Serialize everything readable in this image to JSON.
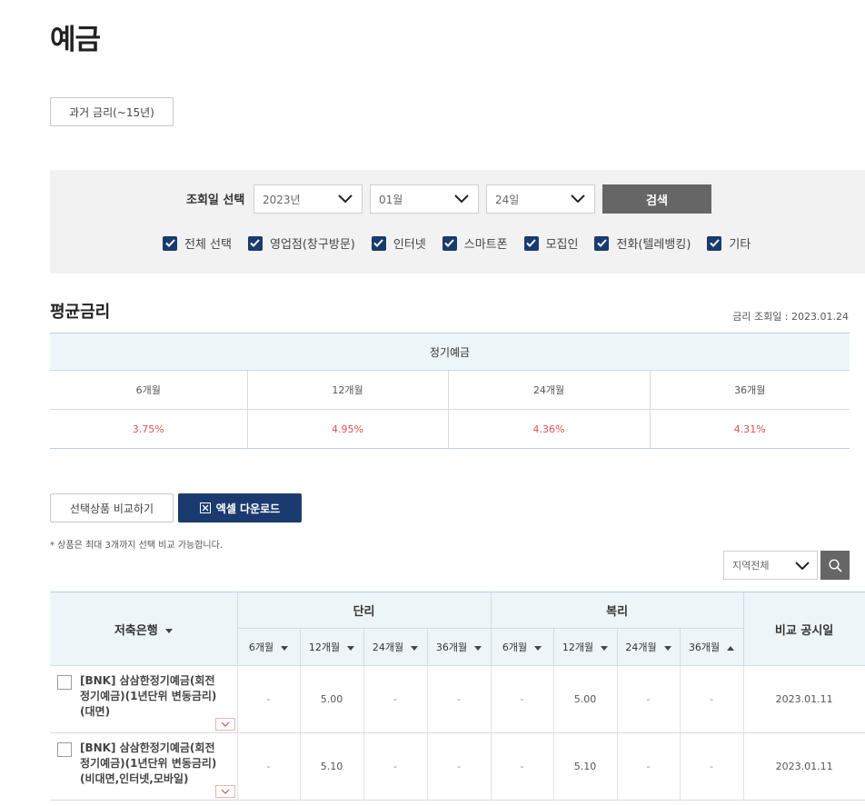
{
  "page": {
    "title": "예금",
    "past_rates_label": "과거 금리(~15년)"
  },
  "filter": {
    "label": "조회일 선택",
    "year": "2023년",
    "month": "01월",
    "day": "24일",
    "search_label": "검색",
    "channels": [
      {
        "label": "전체 선택",
        "checked": true
      },
      {
        "label": "영업점(창구방문)",
        "checked": true
      },
      {
        "label": "인터넷",
        "checked": true
      },
      {
        "label": "스마트폰",
        "checked": true
      },
      {
        "label": "모집인",
        "checked": true
      },
      {
        "label": "전화(텔레뱅킹)",
        "checked": true
      },
      {
        "label": "기타",
        "checked": true
      }
    ]
  },
  "average": {
    "title": "평균금리",
    "date_text": "금리 조회일 : 2023.01.24",
    "group": "정기예금",
    "terms": [
      "6개월",
      "12개월",
      "24개월",
      "36개월"
    ],
    "rates": [
      "3.75%",
      "4.95%",
      "4.36%",
      "4.31%"
    ]
  },
  "actions": {
    "compare_label": "선택상품 비교하기",
    "excel_label": "엑셀 다운로드",
    "note": "* 상품은 최대 3개까지 선택 비교 가능합니다.",
    "region": "지역전체"
  },
  "table": {
    "bank_header": "저축은행",
    "simple_header": "단리",
    "compound_header": "복리",
    "date_header": "비교 공시일",
    "terms": [
      "6개월",
      "12개월",
      "24개월",
      "36개월"
    ],
    "rows": [
      {
        "name": "[BNK] 삼삼한정기예금(회전정기예금)(1년단위 변동금리)(대면)",
        "simple": [
          "-",
          "5.00",
          "-",
          "-"
        ],
        "compound": [
          "-",
          "5.00",
          "-",
          "-"
        ],
        "date": "2023.01.11"
      },
      {
        "name": "[BNK] 삼삼한정기예금(회전정기예금)(1년단위 변동금리)(비대면,인터넷,모바일)",
        "simple": [
          "-",
          "5.10",
          "-",
          "-"
        ],
        "compound": [
          "-",
          "5.10",
          "-",
          "-"
        ],
        "date": "2023.01.11"
      }
    ]
  }
}
